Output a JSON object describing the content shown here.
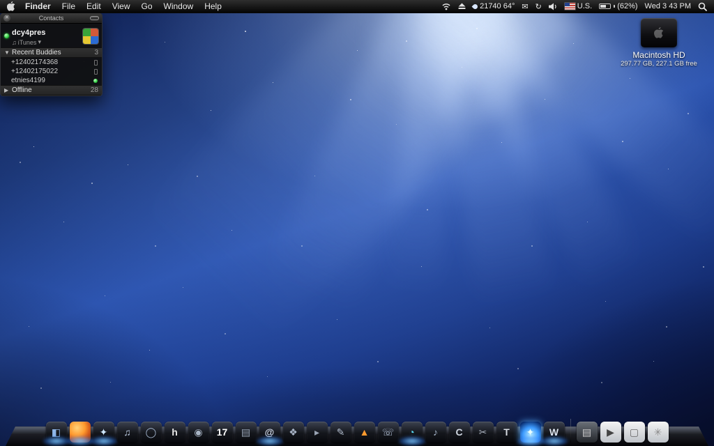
{
  "menu_bar": {
    "app_menu": "Finder",
    "menus": [
      "File",
      "Edit",
      "View",
      "Go",
      "Window",
      "Help"
    ],
    "status": {
      "weather": "21740 64°",
      "keyboard": "U.S.",
      "battery": "(62%)",
      "clock": "Wed 3 43 PM"
    },
    "status_icons": [
      "airport-icon",
      "eject-icon",
      "droplet-icon",
      "mail-icon",
      "sync-icon",
      "volume-icon",
      "us-flag-icon",
      "battery-icon",
      "spotlight-icon"
    ]
  },
  "contacts_window": {
    "title": "Contacts",
    "user": {
      "name": "dcy4pres",
      "status_label": "iTunes"
    },
    "groups": [
      {
        "label": "Recent Buddies",
        "count": "3",
        "disclosure": "▼",
        "expanded": true
      },
      {
        "label": "Offline",
        "count": "28",
        "disclosure": "▶",
        "expanded": false
      }
    ],
    "buddies": [
      {
        "name": "+12402174368",
        "status_icon": "mobile"
      },
      {
        "name": "+12402175022",
        "status_icon": "mobile"
      },
      {
        "name": "etnies4199",
        "status_icon": "online"
      }
    ]
  },
  "desktop_icons": {
    "macintosh_hd": {
      "label": "Macintosh HD",
      "details": "297.77 GB, 227.1 GB free"
    }
  },
  "dock": {
    "accent_glow": "#55aaff",
    "items": [
      {
        "name": "finder",
        "glyph": "◧",
        "color": "#8fb6e8",
        "bg": "dark",
        "running": true
      },
      {
        "name": "firefox",
        "glyph": "",
        "color": "",
        "bg": "fox",
        "running": true
      },
      {
        "name": "safari",
        "glyph": "✦",
        "color": "#cfe8ff",
        "bg": "dark",
        "running": true
      },
      {
        "name": "itunes",
        "glyph": "♫",
        "color": "#b9c7dd",
        "bg": "dark",
        "running": false
      },
      {
        "name": "media-player",
        "glyph": "◯",
        "color": "#9fb0c8",
        "bg": "dark",
        "running": false
      },
      {
        "name": "h-app",
        "glyph": "h",
        "color": "#e6e6e6",
        "bg": "dark",
        "running": false
      },
      {
        "name": "camera-app",
        "glyph": "◉",
        "color": "#a8b4c4",
        "bg": "dark",
        "running": false
      },
      {
        "name": "calendar",
        "glyph": "17",
        "color": "#ffffff",
        "bg": "dark",
        "running": false
      },
      {
        "name": "address-book",
        "glyph": "▤",
        "color": "#9aa7b8",
        "bg": "dark",
        "running": false
      },
      {
        "name": "mail",
        "glyph": "@",
        "color": "#d0d9e8",
        "bg": "dark",
        "running": true
      },
      {
        "name": "photos-app",
        "glyph": "❖",
        "color": "#aab6c8",
        "bg": "dark",
        "running": false
      },
      {
        "name": "game-app",
        "glyph": "▸",
        "color": "#9aa4b4",
        "bg": "dark",
        "running": false
      },
      {
        "name": "pen-app",
        "glyph": "✎",
        "color": "#b0bccc",
        "bg": "dark",
        "running": false
      },
      {
        "name": "vlc",
        "glyph": "▲",
        "color": "#ff9a2e",
        "bg": "dark",
        "running": false
      },
      {
        "name": "phone-app",
        "glyph": "☏",
        "color": "#b6c4da",
        "bg": "dark",
        "running": false
      },
      {
        "name": "dashboard",
        "glyph": "◔",
        "color": "#56d6f0",
        "bg": "dark",
        "running": true
      },
      {
        "name": "radio-app",
        "glyph": "♪",
        "color": "#a8b8cc",
        "bg": "dark",
        "running": false
      },
      {
        "name": "c-app",
        "glyph": "C",
        "color": "#cfd6e0",
        "bg": "dark",
        "running": false
      },
      {
        "name": "tools-app",
        "glyph": "✂",
        "color": "#a8b0bc",
        "bg": "dark",
        "running": false
      },
      {
        "name": "textedit",
        "glyph": "T",
        "color": "#d8dce2",
        "bg": "dark",
        "running": false
      },
      {
        "name": "blue-flame-app",
        "glyph": "✦",
        "color": "#eaffff",
        "bg": "blue",
        "running": true
      },
      {
        "name": "word",
        "glyph": "W",
        "color": "#dfe6f0",
        "bg": "dark",
        "running": true
      },
      {
        "type": "separator"
      },
      {
        "name": "documents-stack",
        "glyph": "▤",
        "color": "#cfcfcf",
        "bg": "mid",
        "running": false
      },
      {
        "name": "movie-file",
        "glyph": "▶",
        "color": "#444444",
        "bg": "light",
        "running": false
      },
      {
        "name": "browser-window",
        "glyph": "▢",
        "color": "#666666",
        "bg": "light",
        "running": false
      },
      {
        "name": "trash",
        "glyph": "✳",
        "color": "#8a8a8a",
        "bg": "light",
        "running": false
      }
    ]
  }
}
